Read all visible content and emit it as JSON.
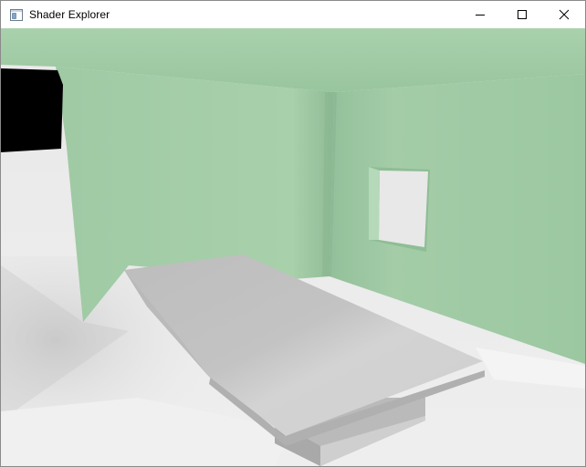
{
  "window": {
    "title": "Shader Explorer",
    "app_icon": "application-window-icon",
    "controls": {
      "minimize_icon": "minimize-icon",
      "maximize_icon": "maximize-icon",
      "close_icon": "close-icon"
    }
  },
  "scene": {
    "description_icon": "3d-render-viewport",
    "colors": {
      "wall": "#a2cba6",
      "floor": "#e6e6e6",
      "table_top": "#c8c8c8",
      "window_opening": "#e8e8e8",
      "shadow": "#000000"
    }
  }
}
